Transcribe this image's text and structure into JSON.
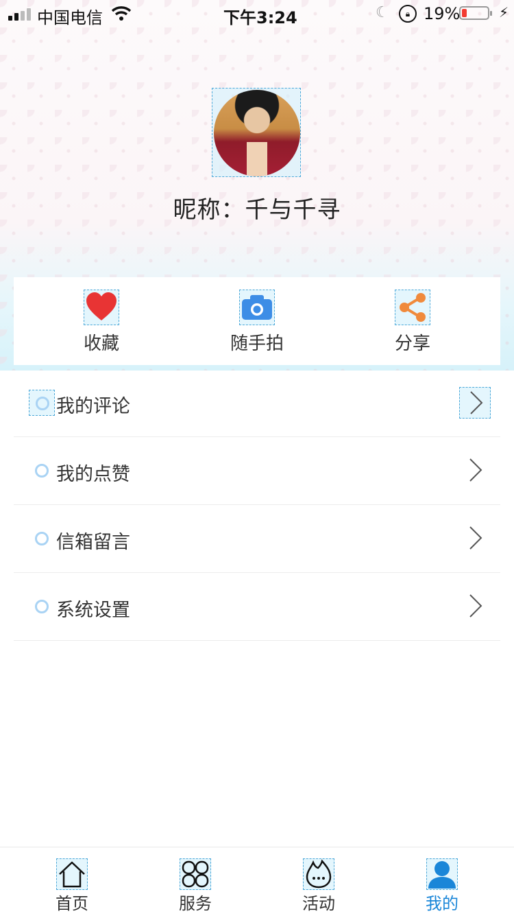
{
  "status_bar": {
    "carrier": "中国电信",
    "time": "下午3:24",
    "battery_percent": "19%",
    "battery_level": 0.19,
    "battery_color": "#f23b32"
  },
  "profile": {
    "nickname": "昵称：千与千寻"
  },
  "actions": [
    {
      "label": "收藏",
      "icon": "heart-icon",
      "color": "#e83434"
    },
    {
      "label": "随手拍",
      "icon": "camera-icon",
      "color": "#3d8de6"
    },
    {
      "label": "分享",
      "icon": "share-icon",
      "color": "#f08a3c"
    }
  ],
  "menu": [
    {
      "label": "我的评论"
    },
    {
      "label": "我的点赞"
    },
    {
      "label": "信箱留言"
    },
    {
      "label": "系统设置"
    }
  ],
  "tabs": [
    {
      "label": "首页",
      "icon": "home-icon"
    },
    {
      "label": "服务",
      "icon": "grid-clover-icon"
    },
    {
      "label": "活动",
      "icon": "flame-chat-icon"
    },
    {
      "label": "我的",
      "icon": "user-icon",
      "active": true
    }
  ],
  "colors": {
    "accent": "#1a86d8",
    "list_dot": "#a9d3f4"
  }
}
